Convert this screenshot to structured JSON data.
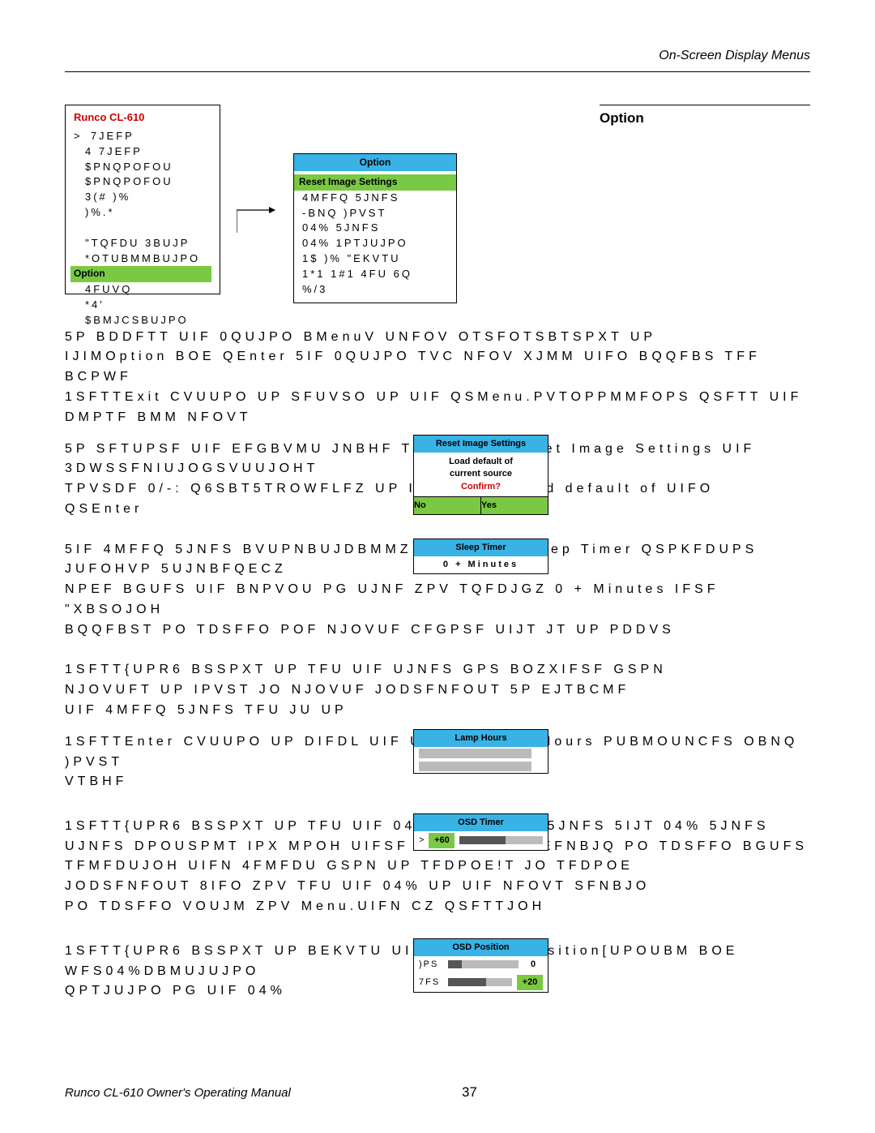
{
  "header": {
    "title": "On-Screen Display Menus"
  },
  "sidebar_heading": "Option",
  "main_menu": {
    "title": "Runco CL-610",
    "caret": ">",
    "items": [
      "7JEFP",
      "4 7JEFP",
      "$PNQPOFOU",
      "$PNQPOFOU",
      "3(# )%",
      ")%.*",
      "",
      "\"TQFDU 3BUJP",
      "*OTUBMMBUJPO"
    ],
    "highlight": "Option",
    "after": [
      "4FUVQ",
      "*4' $BMJCSBUJPO"
    ]
  },
  "option_menu": {
    "title": "Option",
    "highlight": "Reset Image Settings",
    "items": [
      "4MFFQ 5JNFS",
      "-BNQ )PVST",
      "04% 5JNFS",
      "04% 1PTJUJPO",
      "1$   )% \"EKVTU",
      "1*1 1#1 4FU 6Q",
      "%/3"
    ]
  },
  "para1": {
    "l1a": "5P BDDFTT UIF 0QUJPO BMenuV UNFOV OTSFOTSBTSPXT UP",
    "l2": "IJIMOption BOE QEnter 5IF 0QUJPO TVC NFOV XJMM UIFO BQQFBS TFF BCPWF",
    "l3": "1SFTTExit CVUUPO UP SFUVSO UP UIF QSMenu.PVTOPPMMFOPS QSFTT UIF",
    "l4": "DMPTF BMM NFOVT"
  },
  "para_reset": {
    "l1": "5P SFTUPSF UIF EFGBVMU JNBHF TFUUJOHT Reset Image Settings UIF 3DWSSFNIUJOGSVUUJOHT",
    "l2": "TPVSDF 0/-: Q6SBT5TROWFLFZ UP IJHIMJIJU   Load default of   UIFO",
    "l3": "QSEnter",
    "popup": {
      "bar": "Reset Image Settings",
      "line1": "Load default of",
      "line2": "current source",
      "confirm": "Confirm?",
      "no": "No",
      "yes": "Yes"
    }
  },
  "para_sleep": {
    "l1": "5IF 4MFFQ 5JNFS BVUPNBUJDBMMZ QVUT UIF Sleep Timer QSPKFDUPS JUFOHVP 5UJNBFQECZ",
    "l2": "NPEF BGUFS UIF BNPVOU PG UJNF ZPV TQFDJGZ   0 + Minutes   IFSF   \"XBSOJOH",
    "l3": "BQQFBST PO TDSFFO POF NJOVUF CFGPSF UIJT JT UP PDDVS",
    "l4": "",
    "l5": "1SFTT{UPR6 BSSPXT UP TFU UIF UJNFS GPS BOZXIFSF GSPN",
    "l6": "  NJOVUFT UP  IPVST JO  NJOVUF JODSFNFOUT 5P EJTBCMF",
    "l7": "UIF 4MFFQ 5JNFS TFU JU UP",
    "popup": {
      "bar": "Sleep Timer",
      "row": "0 + Minutes"
    }
  },
  "para_lamp": {
    "l1": "1SFTTEnter CVUUPO UP DIFDL UIF UPUBM Lamp Hours PUBMOUNCFS OBNQ )PVST",
    "l2": "VTBHF",
    "popup": {
      "bar": "Lamp Hours"
    }
  },
  "para_osdtimer": {
    "l1": "1SFTT{UPR6 BSSPXT UP TFU UIF 04% OSD Timer 5JNFS   5IJT   04% 5JNFS",
    "l2": "UJNFS DPOUSPMT IPX MPOH UIFSF NFOVT   +60   TEFNBJQ PO TDSFFO BGUFS",
    "l3": "TFMFDUJOH UIFN 4FMFDU GSPN   UP   TFDPOE!T JO   TFDPOE",
    "l4": "JODSFNFOUT 8IFO ZPV TFU UIF 04% UP   UIF NFOVT SFNBJO",
    "l5": "PO TDSFFO VOUJM ZPV Menu.UIFN CZ QSFTTJOH",
    "popup": {
      "bar": "OSD Timer",
      "val": "+60"
    }
  },
  "para_osdpos": {
    "l1": "1SFTT{UPR6 BSSPXT UP BEKVTU UIF IPSJOSD Position[UPOUBM BOE WFS04%DBMUJUJPO",
    "l2": "QPTJUJPO PG UIF 04%",
    "popup": {
      "bar": "OSD Position",
      "r1": ")PS",
      "v1": "0",
      "r2": "7FS",
      "v2": "+20"
    }
  },
  "footer": {
    "left": "Runco CL-610 Owner's Operating Manual",
    "page": "37"
  }
}
